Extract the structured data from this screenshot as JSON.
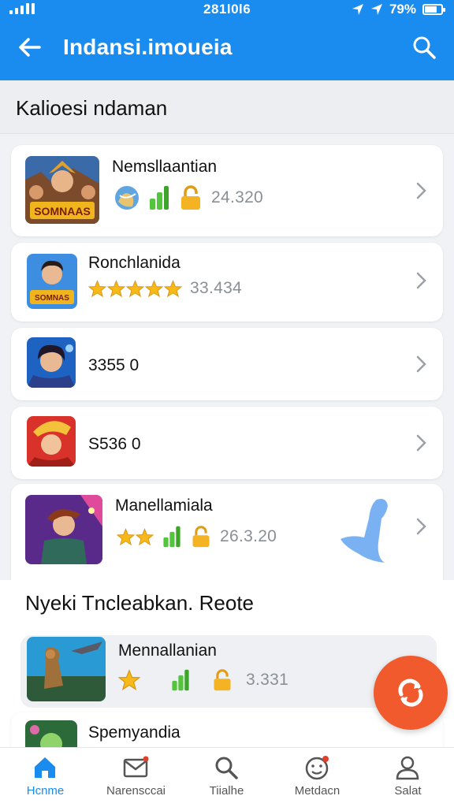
{
  "status": {
    "time": "281l0l6",
    "right_text": "79%"
  },
  "header": {
    "title": "Indansi.imoueia",
    "back_icon": "back-arrow-icon",
    "search_icon": "search-icon"
  },
  "section": {
    "title": "Kalioesi ndaman"
  },
  "games": [
    {
      "name": "Nemsllaantian",
      "count": "24.320",
      "badges": [
        "globe-icon",
        "signal-icon",
        "lock-icon"
      ],
      "thumb_text": "SOMNAAS"
    },
    {
      "name": "Ronchlanida",
      "count": "33.434",
      "stars": 5,
      "thumb_text": "SOMNAS"
    },
    {
      "name": "3355 0"
    },
    {
      "name": "S536 0"
    },
    {
      "name": "Manellamiala",
      "count": "26.3.20",
      "stars": 2,
      "badges": [
        "signal-icon",
        "lock-icon"
      ]
    }
  ],
  "subsection": {
    "title": "Nyeki Tncleabkan. Reote"
  },
  "games2": [
    {
      "name": "Mennallanian",
      "count": "3.331",
      "stars": 1,
      "badges": [
        "signal-icon",
        "lock-icon"
      ]
    },
    {
      "name": "Spemyandia"
    }
  ],
  "nav": [
    {
      "label": "Hcnme",
      "icon": "home-icon",
      "active": true
    },
    {
      "label": "Narensccai",
      "icon": "mail-icon",
      "active": false
    },
    {
      "label": "Tiialhe",
      "icon": "search-icon",
      "active": false
    },
    {
      "label": "Metdacn",
      "icon": "face-icon",
      "active": false
    },
    {
      "label": "Salat",
      "icon": "user-icon",
      "active": false
    }
  ],
  "colors": {
    "accent": "#1a8cf0",
    "fab": "#f05a2c",
    "star": "#f6b919",
    "signal": "#52c53c",
    "lock": "#f4b322"
  }
}
